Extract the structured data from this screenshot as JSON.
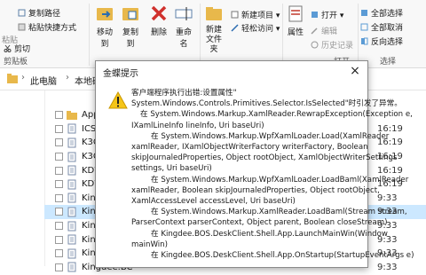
{
  "ribbon": {
    "clipboard": {
      "paste_path": "复制路径",
      "paste_shortcut": "粘贴快捷方式",
      "paste": "粘贴",
      "cut": "剪切",
      "label": "剪贴板"
    },
    "organize": {
      "move_to": "移动到",
      "copy_to": "复制到",
      "delete": "删除",
      "rename": "重命名"
    },
    "new": {
      "new_item": "新建项目 ▾",
      "easy_access": "轻松访问 ▾",
      "new_folder": "新建\n文件夹"
    },
    "open": {
      "properties": "属性",
      "open": "打开 ▾",
      "edit": "编辑",
      "history": "历史记录",
      "label": "打开"
    },
    "select": {
      "select_all": "全部选择",
      "select_none": "全部取消",
      "invert": "反向选择",
      "label": "选择"
    }
  },
  "address": {
    "breadcrumb": [
      "此电脑",
      "本地磁盘 (C:)"
    ]
  },
  "files": [
    {
      "name": "App_Data",
      "time": "",
      "icon": "folder-icon",
      "selected": false
    },
    {
      "name": "ICSharpCo",
      "time": "16:19",
      "icon": "file-icon",
      "selected": false
    },
    {
      "name": "K3Cloud.ico",
      "time": "16:19",
      "icon": "file-icon",
      "selected": false
    },
    {
      "name": "K3CloudDe",
      "time": "16:19",
      "icon": "file-icon",
      "selected": false
    },
    {
      "name": "KDWrapper",
      "time": "16:19",
      "icon": "file-icon",
      "selected": false
    },
    {
      "name": "KDWrapper",
      "time": "16:19",
      "icon": "file-icon",
      "selected": false
    },
    {
      "name": "Kingdee.BC",
      "time": "9:33",
      "icon": "file-icon",
      "selected": false
    },
    {
      "name": "Kingdee.BC",
      "time": "9:33",
      "icon": "file-icon",
      "selected": true
    },
    {
      "name": "Kingdee.BC",
      "time": "9:33",
      "icon": "file-icon",
      "selected": false
    },
    {
      "name": "Kingdee.BC",
      "time": "9:33",
      "icon": "file-icon",
      "selected": false
    },
    {
      "name": "Kingdee.BC",
      "time": "9:33",
      "icon": "file-icon",
      "selected": false
    },
    {
      "name": "Kingdee.BC",
      "time": "9:33",
      "icon": "file-icon",
      "selected": false
    }
  ],
  "dialog": {
    "title": "金蝶提示",
    "close": "×",
    "lines": [
      {
        "text": "客户端程序执行出错:设置属性\"",
        "indent": 0
      },
      {
        "text": "System.Windows.Controls.Primitives.Selector.IsSelected\"时引发了异常。",
        "indent": 0
      },
      {
        "text": "在 System.Windows.Markup.XamlReader.RewrapException(Exception e,",
        "indent": 1
      },
      {
        "text": "IXamlLineInfo lineInfo, Uri baseUri)",
        "indent": 0
      },
      {
        "text": "在 System.Windows.Markup.WpfXamlLoader.Load(XamlReader",
        "indent": 2
      },
      {
        "text": "xamlReader, IXamlObjectWriterFactory writerFactory, Boolean",
        "indent": 0
      },
      {
        "text": "skipJournaledProperties, Object rootObject, XamlObjectWriterSettings",
        "indent": 0
      },
      {
        "text": "settings, Uri baseUri)",
        "indent": 0
      },
      {
        "text": "在 System.Windows.Markup.WpfXamlLoader.LoadBaml(XamlReader",
        "indent": 2
      },
      {
        "text": "xamlReader, Boolean skipJournaledProperties, Object rootObject,",
        "indent": 0
      },
      {
        "text": "XamlAccessLevel accessLevel, Uri baseUri)",
        "indent": 0
      },
      {
        "text": "在 System.Windows.Markup.XamlReader.LoadBaml(Stream stream,",
        "indent": 2
      },
      {
        "text": "ParserContext parserContext, Object parent, Boolean closeStream)",
        "indent": 0
      },
      {
        "text": "在 Kingdee.BOS.DeskClient.Shell.App.LaunchMainWin(Window",
        "indent": 2
      },
      {
        "text": "mainWin)",
        "indent": 0
      },
      {
        "text": "在 Kingdee.BOS.DeskClient.Shell.App.OnStartup(StartupEventArgs e)",
        "indent": 2
      }
    ]
  },
  "colors": {
    "selected_row": "#cce8ff",
    "delete_red": "#d0312d",
    "folder_yellow": "#e8b84b",
    "warning_yellow": "#f5c518"
  }
}
